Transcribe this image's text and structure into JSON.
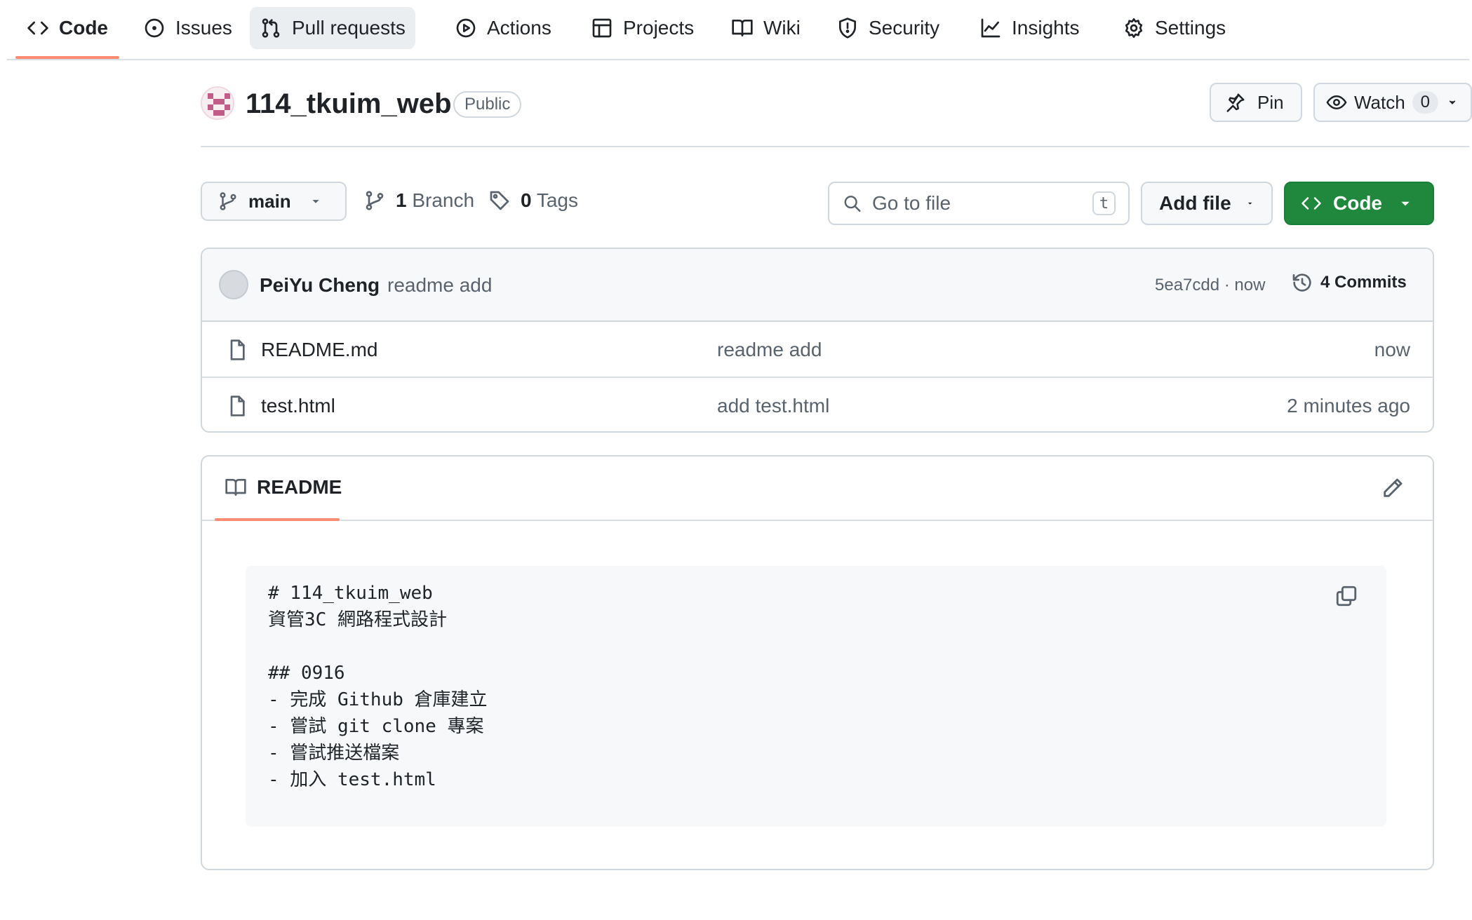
{
  "nav": {
    "tabs": [
      {
        "label": "Code",
        "icon": "code-icon"
      },
      {
        "label": "Issues",
        "icon": "issue-icon"
      },
      {
        "label": "Pull requests",
        "icon": "pull-request-icon"
      },
      {
        "label": "Actions",
        "icon": "play-icon"
      },
      {
        "label": "Projects",
        "icon": "table-icon"
      },
      {
        "label": "Wiki",
        "icon": "book-icon"
      },
      {
        "label": "Security",
        "icon": "shield-icon"
      },
      {
        "label": "Insights",
        "icon": "graph-icon"
      },
      {
        "label": "Settings",
        "icon": "gear-icon"
      }
    ],
    "selected": "Code",
    "hovered": "Pull requests"
  },
  "repo": {
    "name": "114_tkuim_web",
    "visibility": "Public"
  },
  "actions": {
    "pin_label": "Pin",
    "watch_label": "Watch",
    "watch_count": "0"
  },
  "branch": {
    "current": "main",
    "branch_count": "1",
    "branch_label": "Branch",
    "tag_count": "0",
    "tag_label": "Tags"
  },
  "search": {
    "placeholder": "Go to file",
    "shortcut": "t"
  },
  "buttons": {
    "add_file": "Add file",
    "code": "Code"
  },
  "latest_commit": {
    "author": "PeiYu Cheng",
    "message": "readme add",
    "meta": "5ea7cdd · now",
    "commits_label": "4 Commits"
  },
  "files": [
    {
      "name": "README.md",
      "commit": "readme add",
      "time": "now"
    },
    {
      "name": "test.html",
      "commit": "add test.html",
      "time": "2 minutes ago"
    }
  ],
  "readme": {
    "tab_label": "README",
    "lines": [
      "# 114_tkuim_web",
      "資管3C 網路程式設計",
      "",
      "## 0916",
      "- 完成 Github 倉庫建立",
      "- 嘗試 git clone 專案",
      "- 嘗試推送檔案",
      "- 加入 test.html"
    ]
  },
  "colors": {
    "accent_underline": "#fd8c73",
    "primary_button": "#1f883d",
    "border": "#d0d7de",
    "muted_text": "#59636e"
  }
}
